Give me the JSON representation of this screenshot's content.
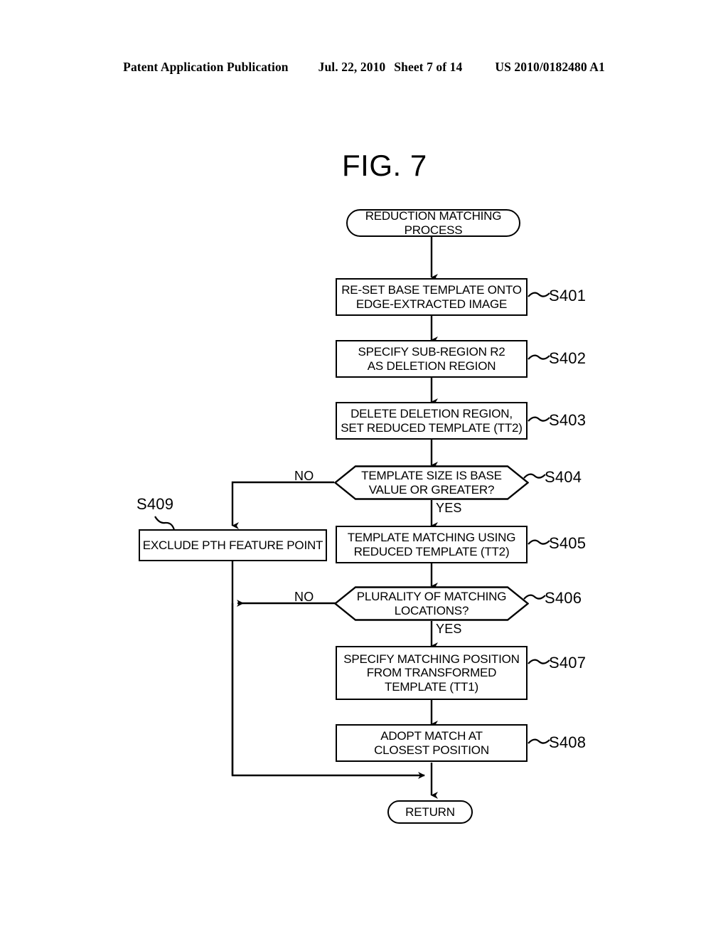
{
  "header": {
    "publication": "Patent Application Publication",
    "date": "Jul. 22, 2010",
    "sheet": "Sheet 7 of 14",
    "patent_number": "US 2010/0182480 A1"
  },
  "figure": {
    "title": "FIG. 7"
  },
  "flowchart": {
    "start": {
      "label": "REDUCTION MATCHING\nPROCESS",
      "shape": "terminator"
    },
    "end": {
      "label": "RETURN",
      "shape": "terminator"
    },
    "steps": [
      {
        "id": "s401",
        "ref": "S401",
        "label": "RE-SET BASE TEMPLATE ONTO\nEDGE-EXTRACTED IMAGE",
        "shape": "process"
      },
      {
        "id": "s402",
        "ref": "S402",
        "label": "SPECIFY SUB-REGION R2\nAS DELETION REGION",
        "shape": "process"
      },
      {
        "id": "s403",
        "ref": "S403",
        "label": "DELETE DELETION REGION,\nSET REDUCED TEMPLATE (TT2)",
        "shape": "process"
      },
      {
        "id": "s404",
        "ref": "S404",
        "label": "TEMPLATE SIZE IS BASE\nVALUE OR GREATER?",
        "shape": "decision"
      },
      {
        "id": "s409",
        "ref": "S409",
        "label": "EXCLUDE PTH FEATURE POINT",
        "shape": "process"
      },
      {
        "id": "s405",
        "ref": "S405",
        "label": "TEMPLATE MATCHING USING\nREDUCED TEMPLATE (TT2)",
        "shape": "process"
      },
      {
        "id": "s406",
        "ref": "S406",
        "label": "PLURALITY OF MATCHING\nLOCATIONS?",
        "shape": "decision"
      },
      {
        "id": "s407",
        "ref": "S407",
        "label": "SPECIFY MATCHING POSITION\nFROM TRANSFORMED\nTEMPLATE (TT1)",
        "shape": "process"
      },
      {
        "id": "s408",
        "ref": "S408",
        "label": "ADOPT MATCH AT\nCLOSEST POSITION",
        "shape": "process"
      }
    ],
    "branch_labels": {
      "s404_no": "NO",
      "s404_yes": "YES",
      "s406_no": "NO",
      "s406_yes": "YES"
    }
  },
  "colors": {
    "ink": "#000000",
    "paper": "#ffffff"
  }
}
